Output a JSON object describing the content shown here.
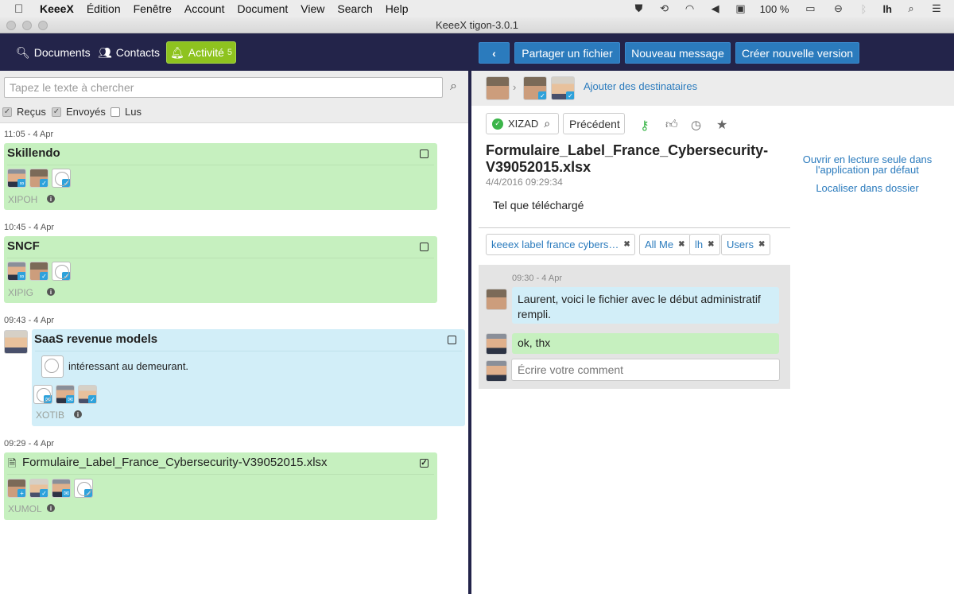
{
  "menubar": {
    "app": "KeeeX",
    "items": [
      "Édition",
      "Fenêtre",
      "Account",
      "Document",
      "View",
      "Search",
      "Help"
    ],
    "battery": "100 %",
    "user": "lh"
  },
  "window": {
    "title": "KeeeX tigon-3.0.1"
  },
  "toolbar": {
    "documents": "Documents",
    "contacts": "Contacts",
    "activity": "Activité",
    "activity_count": "5",
    "share_file": "Partager un fichier",
    "new_message": "Nouveau message",
    "new_version": "Créer nouvelle version"
  },
  "left": {
    "search_placeholder": "Tapez le texte à chercher",
    "filters": [
      {
        "label": "Reçus",
        "checked": true
      },
      {
        "label": "Envoyés",
        "checked": true
      },
      {
        "label": "Lus",
        "checked": false
      }
    ],
    "items": [
      {
        "time": "11:05 - 4 Apr",
        "title": "Skillendo",
        "ref": "XIPOH"
      },
      {
        "time": "10:45 - 4 Apr",
        "title": "SNCF",
        "ref": "XIPIG"
      },
      {
        "time": "09:43 - 4 Apr",
        "title": "SaaS revenue models",
        "message": "intéressant au demeurant.",
        "ref": "XOTIB"
      },
      {
        "time": "09:29 - 4 Apr",
        "title": "Formulaire_Label_France_Cybersecurity-V39052015.xlsx",
        "ref": "XUMOL"
      }
    ]
  },
  "right": {
    "add_recipients": "Ajouter des destinataires",
    "ref_label": "XIZAD",
    "previous": "Précédent",
    "doc_title": "Formulaire_Label_France_Cybersecurity-V39052015.xlsx",
    "doc_date": "4/4/2016 09:29:34",
    "doc_description": "Tel que téléchargé",
    "open_readonly": "Ouvrir en lecture seule dans l'application par défaut",
    "locate_folder": "Localiser dans dossier",
    "tags": [
      "keeex label france cybers…",
      "All Me",
      "lh",
      "Users"
    ],
    "comments_time": "09:30 - 4 Apr",
    "comment_1": "Laurent, voici le fichier avec le début administratif rempli.",
    "comment_2": "ok, thx",
    "comment_placeholder": "Écrire votre comment"
  },
  "colors": {
    "toolbar_bg": "#23244a",
    "activity_green": "#8ec31f",
    "action_blue": "#2b7bbd",
    "card_green": "#c6f0bf",
    "card_blue": "#d2eef8"
  }
}
